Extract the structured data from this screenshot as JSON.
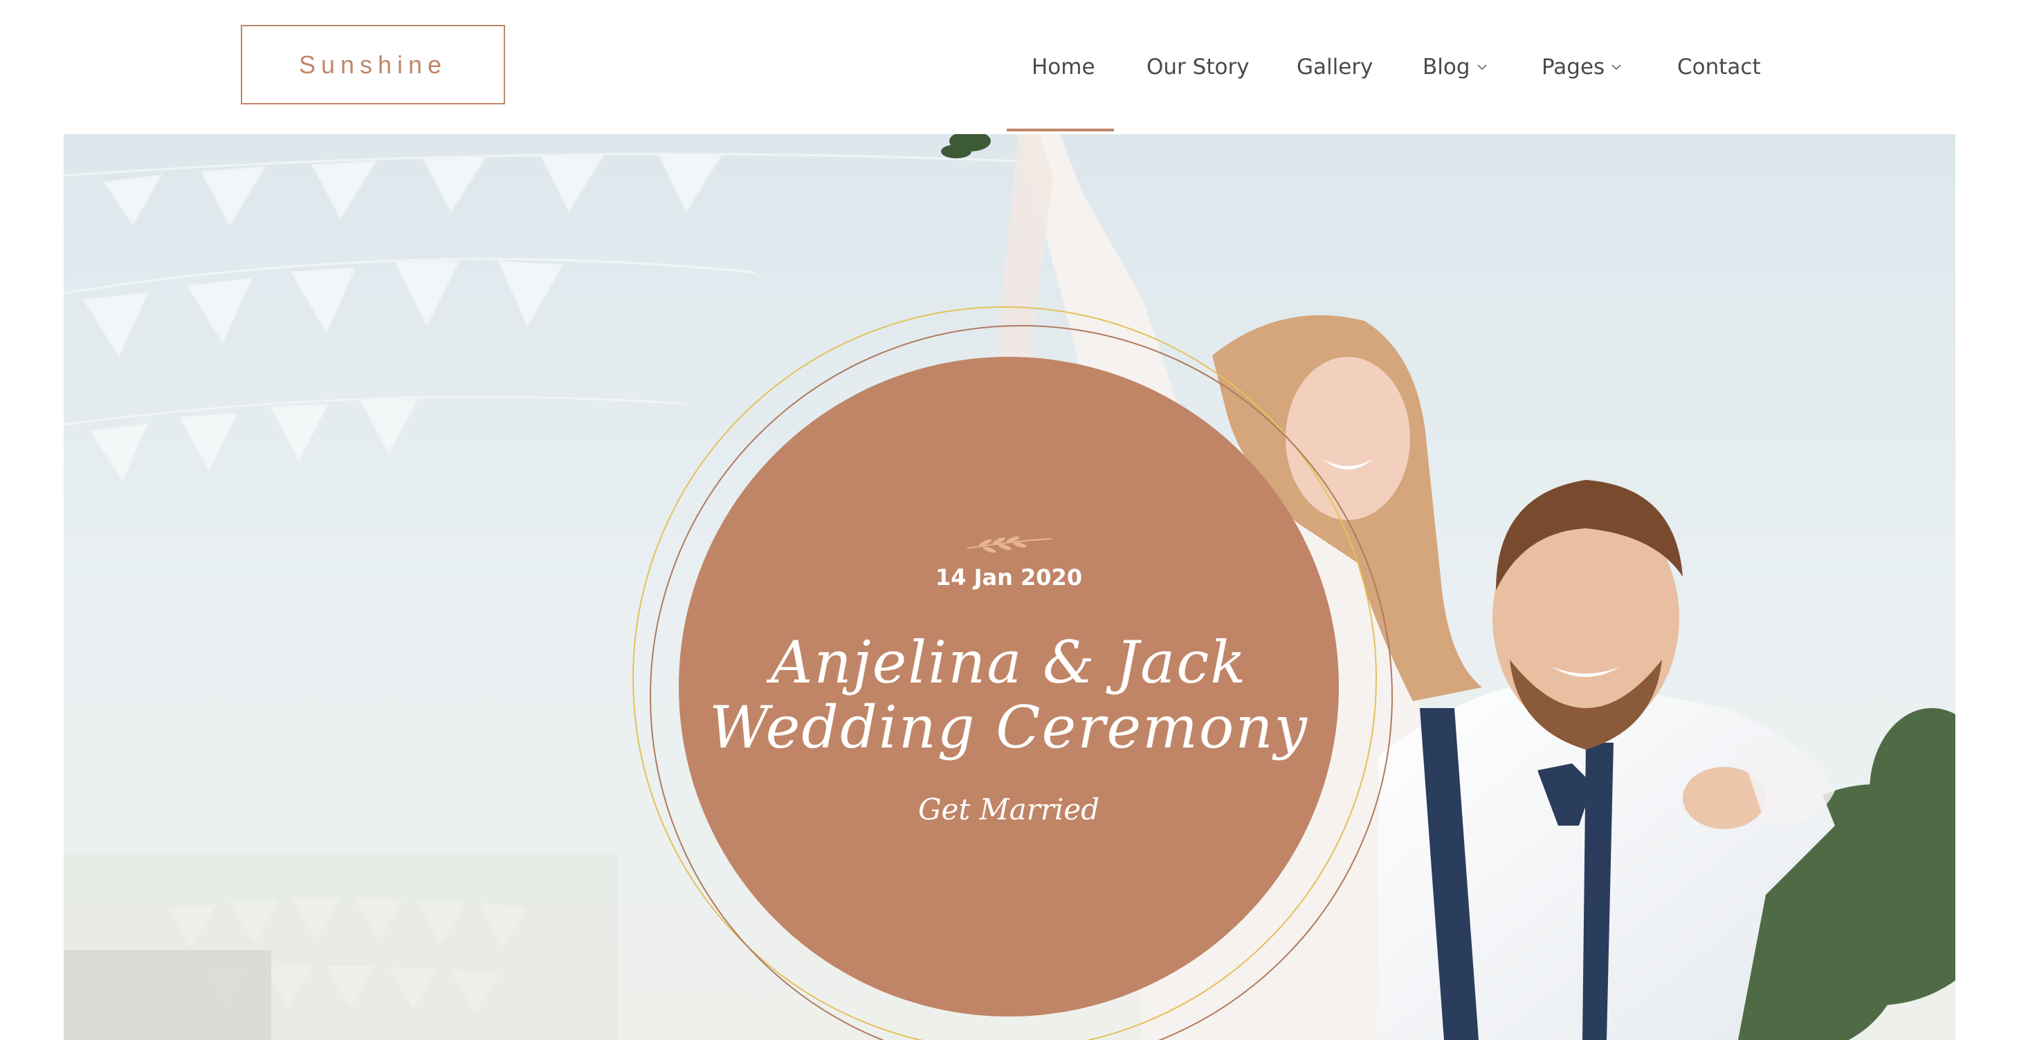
{
  "brand": {
    "logo_text": "Sunshine",
    "accent_color": "#c08768"
  },
  "nav": {
    "items": [
      {
        "label": "Home",
        "active": true,
        "has_dropdown": false
      },
      {
        "label": "Our Story",
        "active": false,
        "has_dropdown": false
      },
      {
        "label": "Gallery",
        "active": false,
        "has_dropdown": false
      },
      {
        "label": "Blog",
        "active": false,
        "has_dropdown": true,
        "icon": "chevron-down-icon"
      },
      {
        "label": "Pages",
        "active": false,
        "has_dropdown": true,
        "icon": "chevron-down-icon"
      },
      {
        "label": "Contact",
        "active": false,
        "has_dropdown": false
      }
    ]
  },
  "hero": {
    "date": "14 Jan 2020",
    "title_line1": "Anjelina & Jack",
    "title_line2": "Wedding Ceremony",
    "subtitle": "Get Married",
    "decor_icon": "leaf-branch-icon",
    "circle_color": "#c08566",
    "ring_colors": [
      "#e3c25a",
      "#b07a60"
    ],
    "background_image": "wedding-couple-photo"
  }
}
